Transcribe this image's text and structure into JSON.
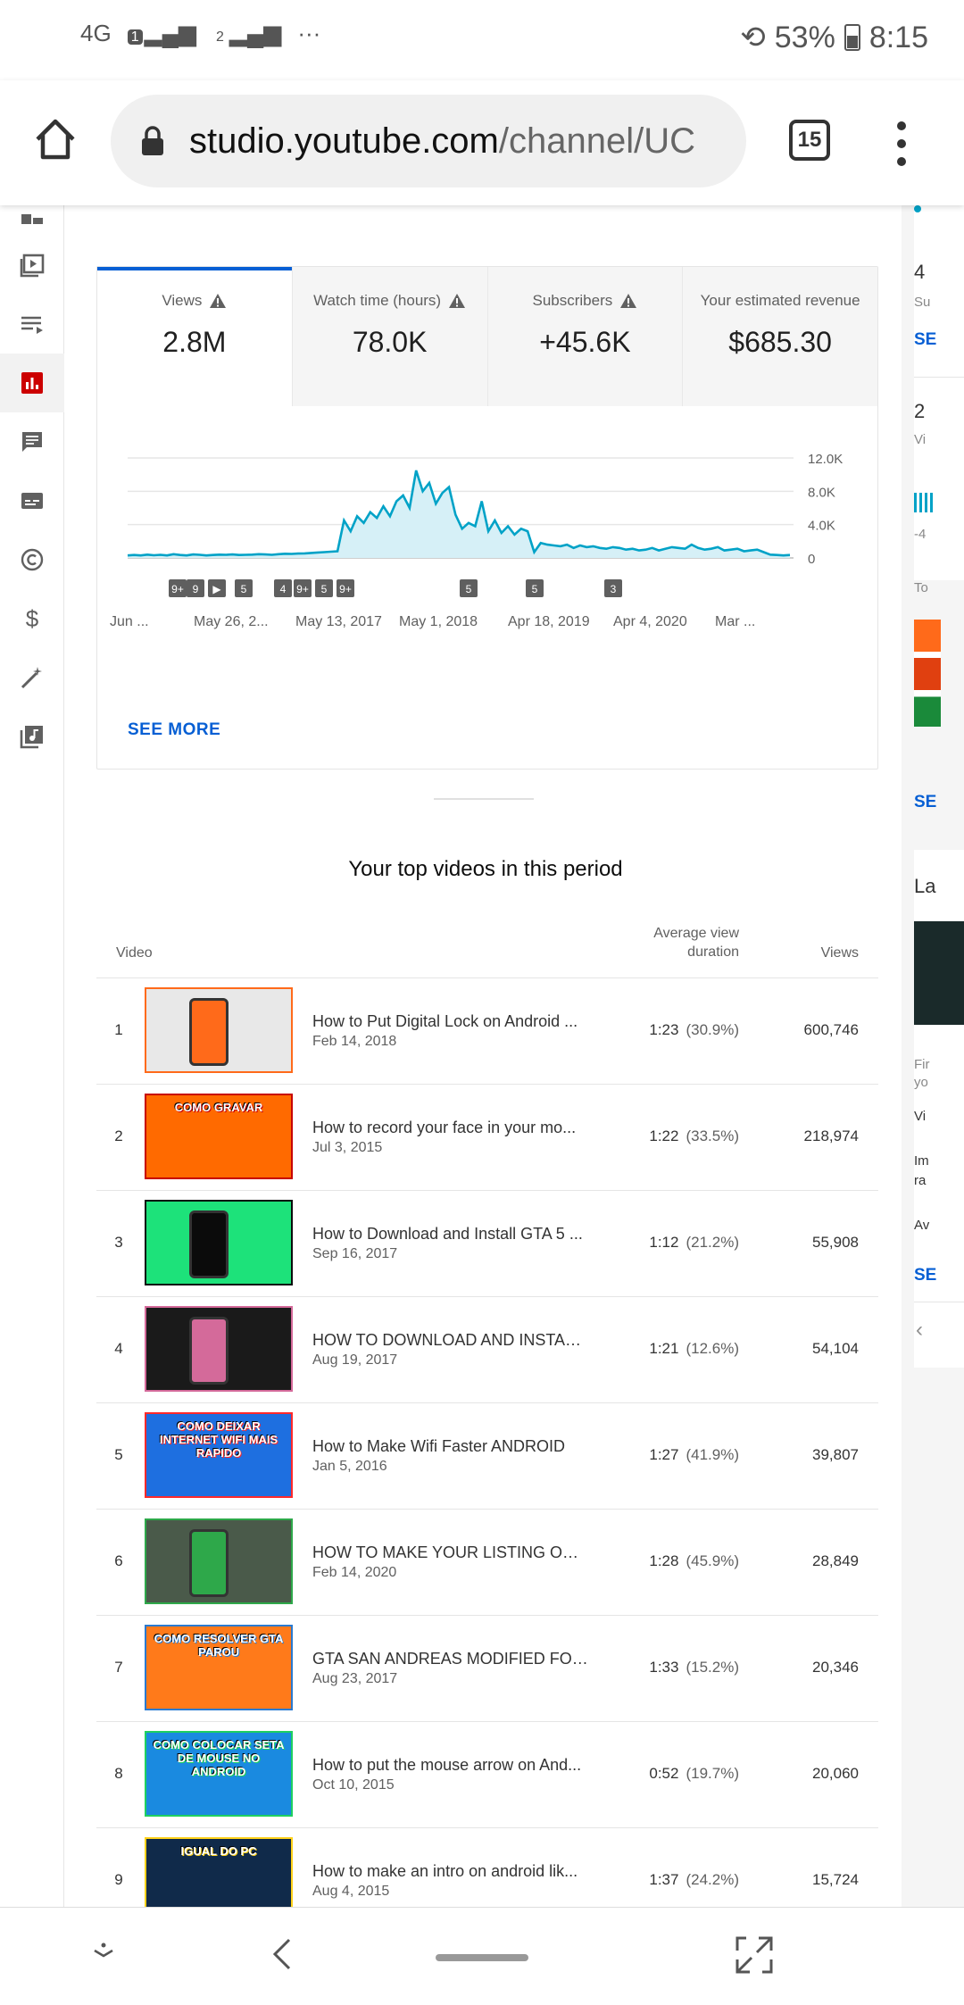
{
  "status_bar": {
    "network": "4G",
    "sim1": "1",
    "sim2": "2",
    "more": "···",
    "battery": "53%",
    "time": "8:15"
  },
  "browser": {
    "url_host": "studio.youtube.com",
    "url_path": "/channel/UC",
    "tab_count": "15"
  },
  "metrics": [
    {
      "label": "Views",
      "value": "2.8M",
      "active": true
    },
    {
      "label": "Watch time (hours)",
      "value": "78.0K"
    },
    {
      "label": "Subscribers",
      "value": "+45.6K"
    },
    {
      "label": "Your estimated revenue",
      "value": "$685.30"
    }
  ],
  "chart_data": {
    "type": "area",
    "y_ticks": [
      "12.0K",
      "8.0K",
      "4.0K",
      "0"
    ],
    "x_ticks": [
      "Jun ...",
      "May 26, 2...",
      "May 13, 2017",
      "May 1, 2018",
      "Apr 18, 2019",
      "Apr 4, 2020",
      "Mar ..."
    ],
    "ylim": [
      0,
      12000
    ],
    "markers": [
      "9+",
      "9",
      "▶",
      "5",
      "4",
      "9+",
      "5",
      "9+",
      "5",
      "5",
      "3"
    ],
    "series": [
      {
        "values": [
          300,
          350,
          300,
          400,
          320,
          380,
          300,
          450,
          350,
          300,
          420,
          380,
          300,
          350,
          400,
          380,
          420,
          350,
          380,
          400,
          450,
          420,
          380,
          450,
          500,
          480,
          520,
          550,
          600,
          650,
          700,
          750,
          800,
          4500,
          3200,
          5000,
          4200,
          5500,
          4800,
          6200,
          5000,
          6800,
          7500,
          6000,
          10500,
          8000,
          9000,
          6500,
          7800,
          8500,
          5200,
          3500,
          4200,
          3800,
          6800,
          3200,
          4500,
          3000,
          3800,
          2800,
          3500,
          3200,
          700,
          1800,
          1600,
          1500,
          1400,
          1600,
          1200,
          1500,
          1300,
          1400,
          1200,
          1100,
          1300,
          1200,
          1000,
          1100,
          900,
          1000,
          1200,
          900,
          1100,
          1300,
          1200,
          1100,
          1600,
          1200,
          1000,
          1100,
          1300,
          900,
          1000,
          1100,
          800,
          900,
          1000,
          700,
          400,
          350,
          300,
          350
        ]
      }
    ]
  },
  "see_more": "SEE MORE",
  "top_videos": {
    "title": "Your top videos in this period",
    "headers": {
      "video": "Video",
      "avd_line1": "Average view",
      "avd_line2": "duration",
      "views": "Views"
    },
    "rows": [
      {
        "rank": "1",
        "title": "How to Put Digital Lock on Android ...",
        "date": "Feb 14, 2018",
        "duration": "1:23",
        "percent": "(30.9%)",
        "views": "600,746"
      },
      {
        "rank": "2",
        "title": "How to record your face in your mo...",
        "date": "Jul 3, 2015",
        "duration": "1:22",
        "percent": "(33.5%)",
        "views": "218,974"
      },
      {
        "rank": "3",
        "title": "How to Download and Install GTA 5 ...",
        "date": "Sep 16, 2017",
        "duration": "1:12",
        "percent": "(21.2%)",
        "views": "55,908"
      },
      {
        "rank": "4",
        "title": "HOW TO DOWNLOAD AND INSTALL...",
        "date": "Aug 19, 2017",
        "duration": "1:21",
        "percent": "(12.6%)",
        "views": "54,104"
      },
      {
        "rank": "5",
        "title": "How to Make Wifi Faster ANDROID",
        "date": "Jan 5, 2016",
        "duration": "1:27",
        "percent": "(41.9%)",
        "views": "39,807"
      },
      {
        "rank": "6",
        "title": "HOW TO MAKE YOUR LISTING ONLI...",
        "date": "Feb 14, 2020",
        "duration": "1:28",
        "percent": "(45.9%)",
        "views": "28,849"
      },
      {
        "rank": "7",
        "title": "GTA SAN ANDREAS MODIFIED FOR ...",
        "date": "Aug 23, 2017",
        "duration": "1:33",
        "percent": "(15.2%)",
        "views": "20,346"
      },
      {
        "rank": "8",
        "title": "How to put the mouse arrow on And...",
        "date": "Oct 10, 2015",
        "duration": "0:52",
        "percent": "(19.7%)",
        "views": "20,060"
      },
      {
        "rank": "9",
        "title": "How to make an intro on android lik...",
        "date": "Aug 4, 2015",
        "duration": "1:37",
        "percent": "(24.2%)",
        "views": "15,724"
      }
    ]
  },
  "thumbnails": [
    {
      "text": "",
      "bg": "#e8e8e8",
      "accent": "#ff6a1a"
    },
    {
      "text": "COMO GRAVAR",
      "bg": "#ff6a00",
      "accent": "#c80000"
    },
    {
      "text": "",
      "bg": "#1de27a",
      "accent": "#0b0b0b"
    },
    {
      "text": "",
      "bg": "#1a1a1a",
      "accent": "#d46a9a"
    },
    {
      "text": "COMO DEIXAR INTERNET WIFI MAIS RAPIDO",
      "bg": "#1e6fe0",
      "accent": "#ff2a2a"
    },
    {
      "text": "",
      "bg": "#4a5a4a",
      "accent": "#2ea84a"
    },
    {
      "text": "COMO RESOLVER GTA PAROU",
      "bg": "#ff7a1a",
      "accent": "#2a7ad0"
    },
    {
      "text": "COMO COLOCAR SETA DE MOUSE NO ANDROID",
      "bg": "#1a8ae0",
      "accent": "#1ed060"
    },
    {
      "text": "IGUAL DO PC",
      "bg": "#102a4a",
      "accent": "#ffd21a"
    }
  ],
  "right_col": {
    "a": "4",
    "b": "Su",
    "see1": "SE",
    "c": "2",
    "d": "Vi",
    "e": "-4",
    "f": "To",
    "see2": "SE",
    "g": "La",
    "h": "Fir",
    "i": "yo",
    "j": "Vi",
    "k": "Im",
    "l": "ra",
    "m": "Av",
    "see3": "SE"
  },
  "colors": {
    "accent": "#065fd4",
    "chart_line": "#00a2c7",
    "chart_fill": "#d6f0f7",
    "analytics_red": "#cc0000"
  }
}
